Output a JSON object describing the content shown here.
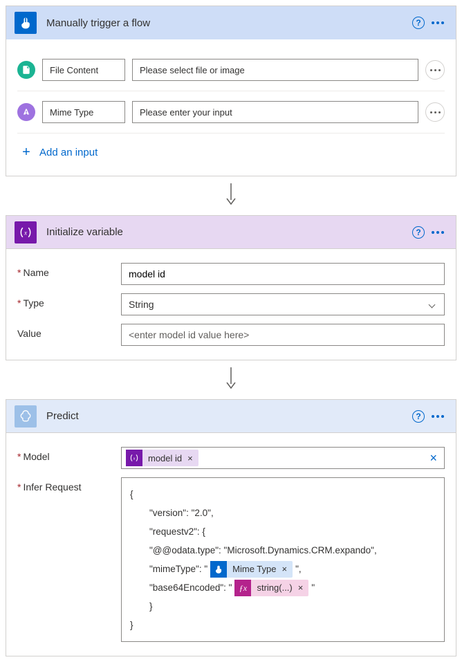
{
  "trigger": {
    "title": "Manually trigger a flow",
    "inputs": [
      {
        "icon": "file",
        "label": "File Content",
        "placeholder": "Please select file or image"
      },
      {
        "icon": "text",
        "label": "Mime Type",
        "placeholder": "Please enter your input"
      }
    ],
    "add_label": "Add an input"
  },
  "initvar": {
    "title": "Initialize variable",
    "name_label": "Name",
    "name_value": "model id",
    "type_label": "Type",
    "type_value": "String",
    "value_label": "Value",
    "value_placeholder": "<enter model id value here>"
  },
  "predict": {
    "title": "Predict",
    "model_label": "Model",
    "model_token": "model id",
    "infer_label": "Infer Request",
    "json": {
      "open": "{",
      "version": "\"version\": \"2.0\",",
      "requestv2": "\"requestv2\": {",
      "odata": "\"@@odata.type\": \"Microsoft.Dynamics.CRM.expando\",",
      "mime_pre": "\"mimeType\": \"",
      "mime_token": "Mime Type",
      "mime_post": "\",",
      "b64_pre": "\"base64Encoded\": \"",
      "b64_token": "string(...)",
      "b64_post": "\"",
      "close1": "}",
      "close2": "}"
    }
  }
}
